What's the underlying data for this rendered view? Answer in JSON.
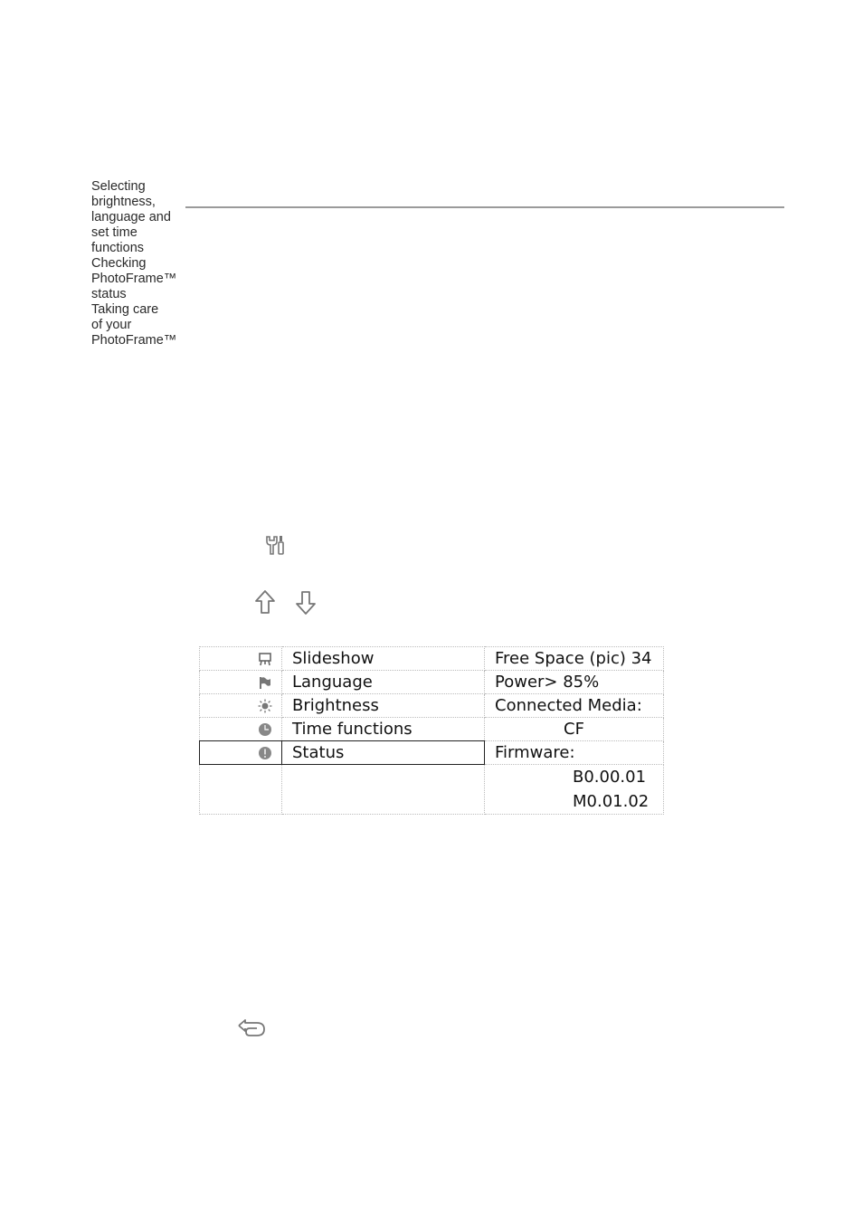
{
  "sidebar": {
    "items": [
      "Selecting brightness, language and set time functions",
      "Checking PhotoFrame™ status",
      "Taking care of your PhotoFrame™"
    ],
    "lines": [
      "Selecting",
      "brightness,",
      "language and",
      "set time",
      "functions",
      "Checking",
      "PhotoFrame™",
      "status",
      "Taking care",
      "of your",
      "PhotoFrame™"
    ]
  },
  "icons": {
    "settings": "settings-tools-icon",
    "up": "arrow-up-icon",
    "down": "arrow-down-icon",
    "back": "back-return-icon"
  },
  "menu": {
    "rows": [
      {
        "icon": "slideshow-icon",
        "label": "Slideshow",
        "info": "Free Space (pic) 34"
      },
      {
        "icon": "language-flag-icon",
        "label": "Language",
        "info": "Power> 85%"
      },
      {
        "icon": "brightness-sun-icon",
        "label": "Brightness",
        "info": "Connected Media:"
      },
      {
        "icon": "clock-icon",
        "label": "Time functions",
        "info": "CF"
      },
      {
        "icon": "status-info-icon",
        "label": "Status",
        "info": "Firmware:",
        "selected": true
      }
    ],
    "firmware": {
      "b": "B0.00.01",
      "m": "M0.01.02"
    }
  }
}
